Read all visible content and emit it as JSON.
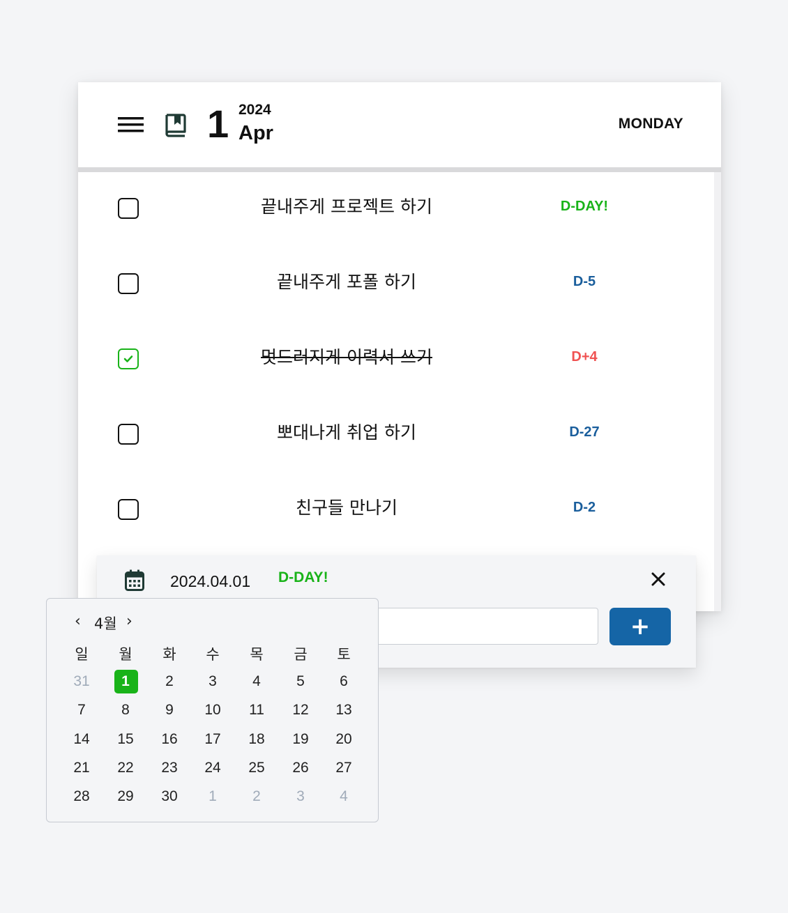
{
  "header": {
    "day": "1",
    "year": "2024",
    "month": "Apr",
    "weekday": "MONDAY",
    "menu_icon": "hamburger-menu-icon",
    "book_icon": "bookmark-book-icon"
  },
  "tasks": [
    {
      "text": "끝내주게 프로젝트 하기",
      "dday": "D-DAY!",
      "checked": false
    },
    {
      "text": "끝내주게 포폴 하기",
      "dday": "D-5",
      "checked": false
    },
    {
      "text": "멋드러지게 이력서 쓰기",
      "dday": "D+4",
      "checked": true
    },
    {
      "text": "뽀대나게 취업 하기",
      "dday": "D-27",
      "checked": false
    },
    {
      "text": "친구들 만나기",
      "dday": "D-2",
      "checked": false
    }
  ],
  "add_panel": {
    "date": "2024.04.01",
    "dday": "D-DAY!",
    "input_value": "",
    "add_label": "+"
  },
  "datepicker": {
    "title": "4월",
    "prev": "‹",
    "next": "›",
    "weekdays": [
      "일",
      "월",
      "화",
      "수",
      "목",
      "금",
      "토"
    ],
    "weeks": [
      [
        "31",
        "1",
        "2",
        "3",
        "4",
        "5",
        "6"
      ],
      [
        "7",
        "8",
        "9",
        "10",
        "11",
        "12",
        "13"
      ],
      [
        "14",
        "15",
        "16",
        "17",
        "18",
        "19",
        "20"
      ],
      [
        "21",
        "22",
        "23",
        "24",
        "25",
        "26",
        "27"
      ],
      [
        "28",
        "29",
        "30",
        "1",
        "2",
        "3",
        "4"
      ]
    ],
    "selected": "1"
  },
  "colors": {
    "dday_today": "#19b319",
    "dday_future": "#1a5e9c",
    "dday_past": "#f05252",
    "check_green": "#19b319",
    "add_button": "#1565a6",
    "selected_day": "#19b319",
    "dark_icon": "#1f3a34"
  }
}
